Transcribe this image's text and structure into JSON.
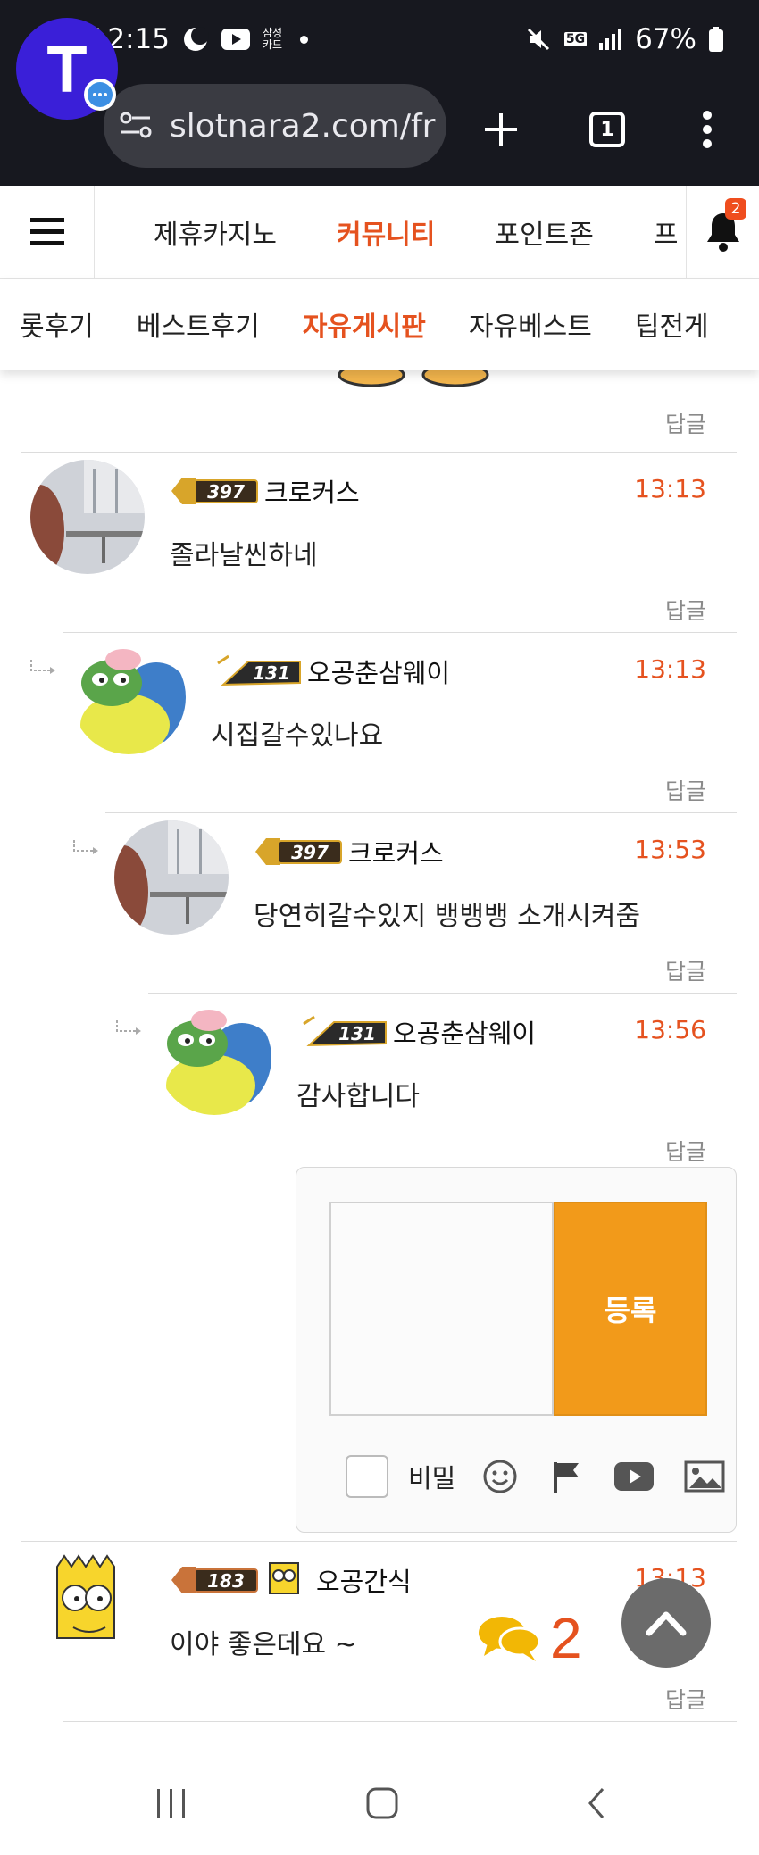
{
  "status_bar": {
    "carrier_time": "SKT 2:15",
    "samsung_card": [
      "삼성",
      "카드"
    ],
    "network": "5G",
    "battery": "67%"
  },
  "browser": {
    "url": "slotnara2.com/fr",
    "tab_count": "1"
  },
  "site_nav": {
    "items": [
      "제휴카지노",
      "커뮤니티",
      "포인트존",
      "프"
    ],
    "active_index": 1,
    "notification_count": "2"
  },
  "sub_nav": {
    "items": [
      "롯후기",
      "베스트후기",
      "자유게시판",
      "자유베스트",
      "팁전게"
    ],
    "active_index": 2
  },
  "reply_label": "답글",
  "comments": [
    {
      "author": "크로커스",
      "level": "397",
      "time": "13:13",
      "text": "졸라날씬하네",
      "avatar": "photo"
    },
    {
      "author": "오공춘삼웨이",
      "level": "131",
      "time": "13:13",
      "text": "시집갈수있나요",
      "avatar": "frog"
    },
    {
      "author": "크로커스",
      "level": "397",
      "time": "13:53",
      "text": "당연히갈수있지 뱅뱅뱅 소개시켜줌",
      "avatar": "photo"
    },
    {
      "author": "오공춘삼웨이",
      "level": "131",
      "time": "13:56",
      "text": "감사합니다",
      "avatar": "frog"
    },
    {
      "author": "오공간식",
      "level": "183",
      "time": "13:13",
      "text": "이야 좋은데요 ~",
      "avatar": "bart"
    }
  ],
  "reply_form": {
    "submit_label": "등록",
    "secret_label": "비밀"
  },
  "floating": {
    "comment_count": "2"
  },
  "colors": {
    "accent": "#e5521f",
    "submit": "#f29a1a",
    "logo": "#3a1fd8",
    "dark_bar": "#17181f"
  }
}
